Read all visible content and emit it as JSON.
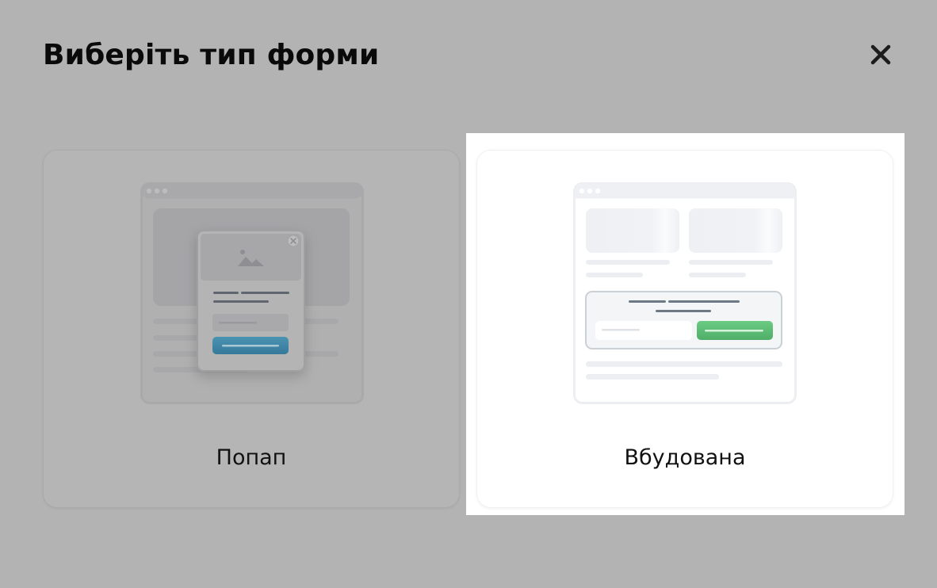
{
  "dialog": {
    "title": "Виберіть тип форми",
    "close_icon": "close-icon"
  },
  "options": [
    {
      "label": "Попап",
      "selected": false,
      "preview_icon": "popup-form-preview"
    },
    {
      "label": "Вбудована",
      "selected": true,
      "preview_icon": "embedded-form-preview"
    }
  ],
  "colors": {
    "overlay": "#b3b3b3",
    "card_selected": "#ffffff",
    "popup_button": "#3f88a8",
    "embedded_button": "#5cbf74",
    "title_text": "#0a0a0a"
  }
}
